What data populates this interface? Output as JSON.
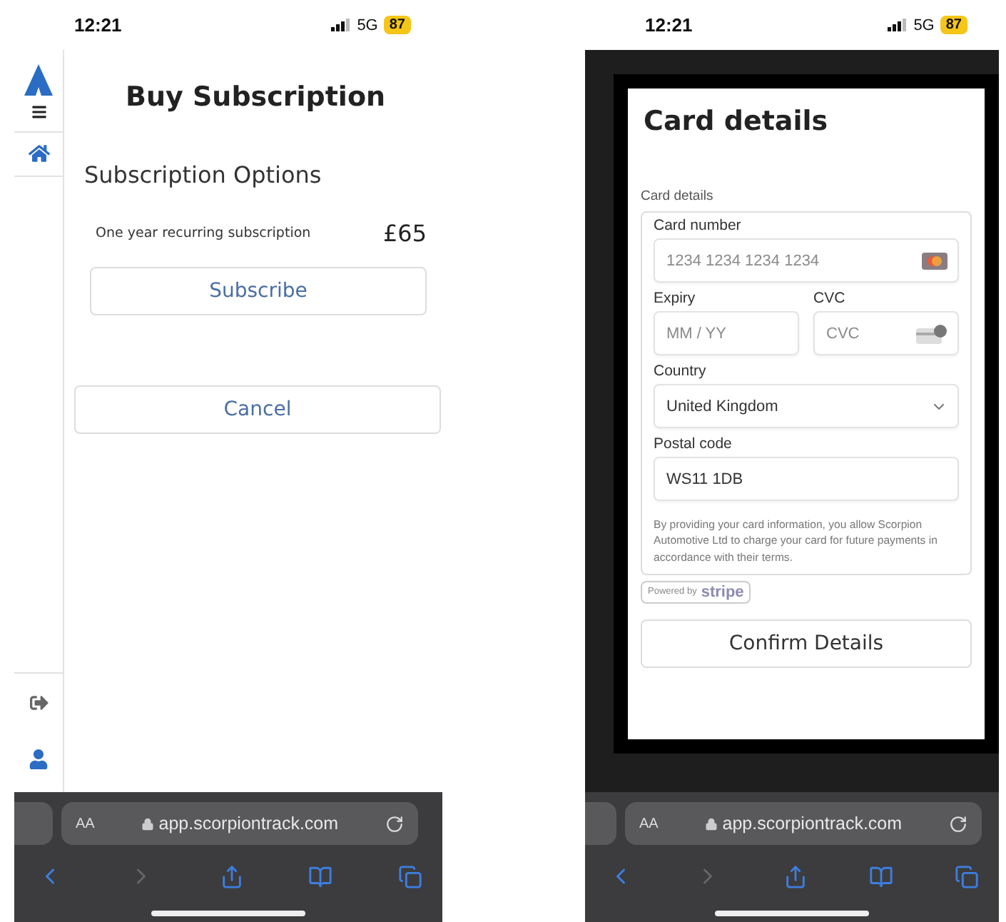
{
  "left_phone": {
    "status_bar": {
      "time": "12:21",
      "network": "5G",
      "battery": "87"
    },
    "page": {
      "title": "Buy Subscription",
      "section_title": "Subscription Options",
      "plan": {
        "label": "One year recurring subscription",
        "price": "£65"
      },
      "subscribe_button": "Subscribe",
      "cancel_button": "Cancel"
    },
    "browser": {
      "text_size": "AA",
      "url": "app.scorpiontrack.com"
    }
  },
  "right_phone": {
    "status_bar": {
      "time": "12:21",
      "network": "5G",
      "battery": "87"
    },
    "modal": {
      "title": "Card details",
      "form_label": "Card details",
      "rows": [
        [
          {
            "kind": "card",
            "label": "Card number",
            "placeholder": "1234 1234 1234 1234"
          }
        ],
        [
          {
            "kind": "plain",
            "label": "Expiry",
            "placeholder": "MM / YY"
          },
          {
            "kind": "cvc",
            "label": "CVC",
            "placeholder": "CVC"
          }
        ],
        [
          {
            "kind": "select",
            "label": "Country",
            "value": "United Kingdom"
          }
        ],
        [
          {
            "kind": "plain",
            "label": "Postal code",
            "value": "WS11 1DB"
          }
        ]
      ],
      "notice": "By providing your card information, you allow Scorpion Automotive Ltd to charge your card for future payments in accordance with their terms.",
      "badge": {
        "prefix": "Powered by",
        "brand": "stripe"
      },
      "confirm_button": "Confirm Details"
    },
    "browser": {
      "text_size": "AA",
      "url": "app.scorpiontrack.com"
    }
  }
}
